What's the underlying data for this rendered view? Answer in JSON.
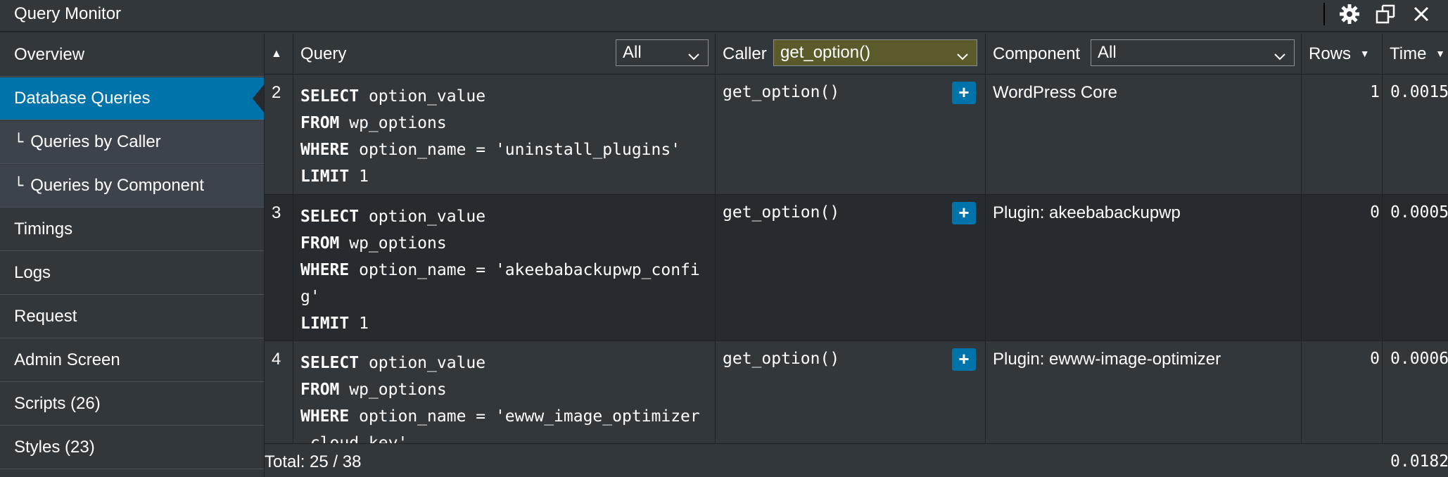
{
  "app": {
    "title": "Query Monitor"
  },
  "toolbar": {
    "settings_icon": "gear-icon",
    "popout_icon": "popout-icon",
    "close_icon": "close-icon"
  },
  "sidebar": {
    "items": [
      {
        "label": "Overview"
      },
      {
        "label": "Database Queries",
        "active": true
      },
      {
        "label": "Queries by Caller",
        "sub": true
      },
      {
        "label": "Queries by Component",
        "sub": true
      },
      {
        "label": "Timings"
      },
      {
        "label": "Logs"
      },
      {
        "label": "Request"
      },
      {
        "label": "Admin Screen"
      },
      {
        "label": "Scripts (26)"
      },
      {
        "label": "Styles (23)"
      }
    ],
    "tree_glyph": "└"
  },
  "table": {
    "sort_indicator": "▲",
    "columns": {
      "query": "Query",
      "query_filter": "All",
      "caller": "Caller",
      "caller_filter": "get_option()",
      "component": "Component",
      "component_filter": "All",
      "rows": "Rows",
      "rows_sort": "▼",
      "time": "Time",
      "time_sort": "▼"
    },
    "rows": [
      {
        "num": "2",
        "sql": [
          {
            "kw": "SELECT",
            "rest": " option_value"
          },
          {
            "kw": "FROM",
            "rest": " wp_options"
          },
          {
            "kw": "WHERE",
            "rest": " option_name = 'uninstall_plugins'"
          },
          {
            "kw": "LIMIT",
            "rest": " 1"
          }
        ],
        "caller": "get_option()",
        "component": "WordPress Core",
        "rows": "1",
        "time": "0.0015"
      },
      {
        "num": "3",
        "sql": [
          {
            "kw": "SELECT",
            "rest": " option_value"
          },
          {
            "kw": "FROM",
            "rest": " wp_options"
          },
          {
            "kw": "WHERE",
            "rest": " option_name = 'akeebabackupwp_config'"
          },
          {
            "kw": "LIMIT",
            "rest": " 1"
          }
        ],
        "caller": "get_option()",
        "component": "Plugin: akeebabackupwp",
        "rows": "0",
        "time": "0.0005"
      },
      {
        "num": "4",
        "sql": [
          {
            "kw": "SELECT",
            "rest": " option_value"
          },
          {
            "kw": "FROM",
            "rest": " wp_options"
          },
          {
            "kw": "WHERE",
            "rest": " option_name = 'ewww_image_optimizer_cloud_key'"
          }
        ],
        "caller": "get_option()",
        "component": "Plugin: ewww-image-optimizer",
        "rows": "0",
        "time": "0.0006"
      }
    ],
    "expand_label": "+",
    "footer": {
      "total": "Total: 25 / 38",
      "time": "0.0182"
    }
  },
  "colors": {
    "accent": "#0073aa",
    "panel": "#32373c",
    "dark": "#272b30",
    "highlight_filter": "#5a5a2a"
  }
}
